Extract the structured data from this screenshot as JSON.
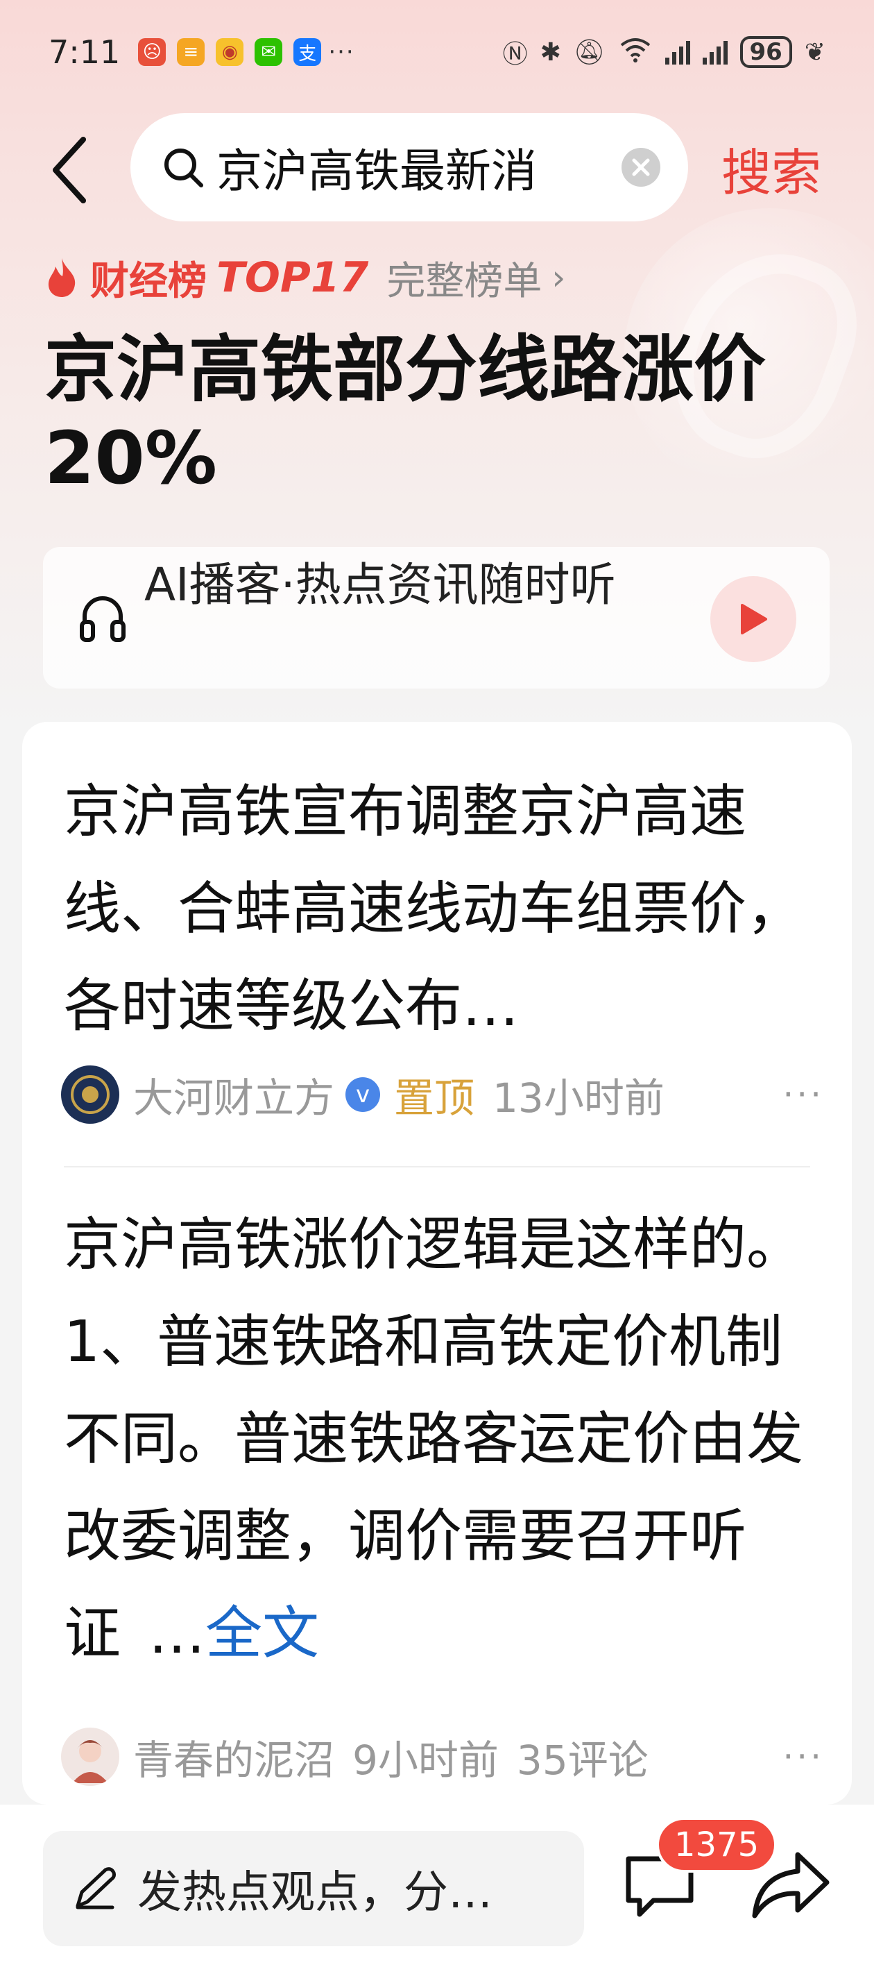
{
  "status_bar": {
    "time": "7:11",
    "app_icons": [
      "app-icon-red",
      "app-icon-orange",
      "weibo-icon",
      "wechat-icon",
      "alipay-icon"
    ],
    "more": "···",
    "wifi_label": "6",
    "battery": "96"
  },
  "search": {
    "query": "京沪高铁最新消",
    "submit_label": "搜索"
  },
  "rank": {
    "board": "财经榜",
    "position": "TOP17",
    "full_list": "完整榜单",
    "chevron": "›"
  },
  "topic": {
    "title": "京沪高铁部分线路涨价20%"
  },
  "podcast": {
    "text": "AI播客·热点资讯随时听"
  },
  "posts": [
    {
      "text": "京沪高铁宣布调整京沪高速线、合蚌高速线动车组票价，各时速等级公布…",
      "author": "大河财立方",
      "verified": "v",
      "pinned": "置顶",
      "time": "13小时前",
      "more": "···"
    },
    {
      "text": "京沪高铁涨价逻辑是这样的。1、普速铁路和高铁定价机制不同。普速铁路客运定价由发改委调整，调价需要召开听证",
      "ellipsis": "…",
      "full_text_link": "全文",
      "author": "青春的泥沼",
      "time": "9小时前",
      "comments": "35评论",
      "more": "···"
    }
  ],
  "bottom_bar": {
    "comment_placeholder": "发热点观点，分…",
    "comment_count": "1375"
  },
  "colors": {
    "accent_red": "#e8423a",
    "link_blue": "#1a68c8",
    "pinned_gold": "#d8a23a"
  }
}
